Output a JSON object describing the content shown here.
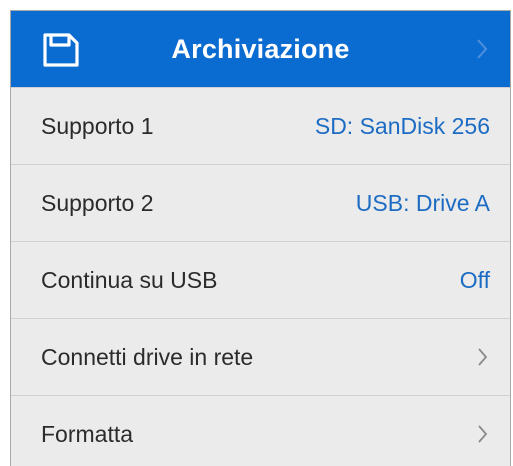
{
  "header": {
    "title": "Archiviazione",
    "icon": "storage-icon",
    "chevron_icon": "chevron-right-icon",
    "background": "#0a6bd0"
  },
  "rows": [
    {
      "label": "Supporto 1",
      "value": "SD: SanDisk 256"
    },
    {
      "label": "Supporto 2",
      "value": "USB: Drive A"
    },
    {
      "label": "Continua su USB",
      "value": "Off"
    },
    {
      "label": "Connetti drive in rete",
      "icon": "chevron-right-icon"
    },
    {
      "label": "Formatta",
      "icon": "chevron-right-icon"
    }
  ],
  "colors": {
    "accent": "#1d6cc4",
    "row_background": "#ebebeb",
    "divider": "#cfcfcf"
  }
}
